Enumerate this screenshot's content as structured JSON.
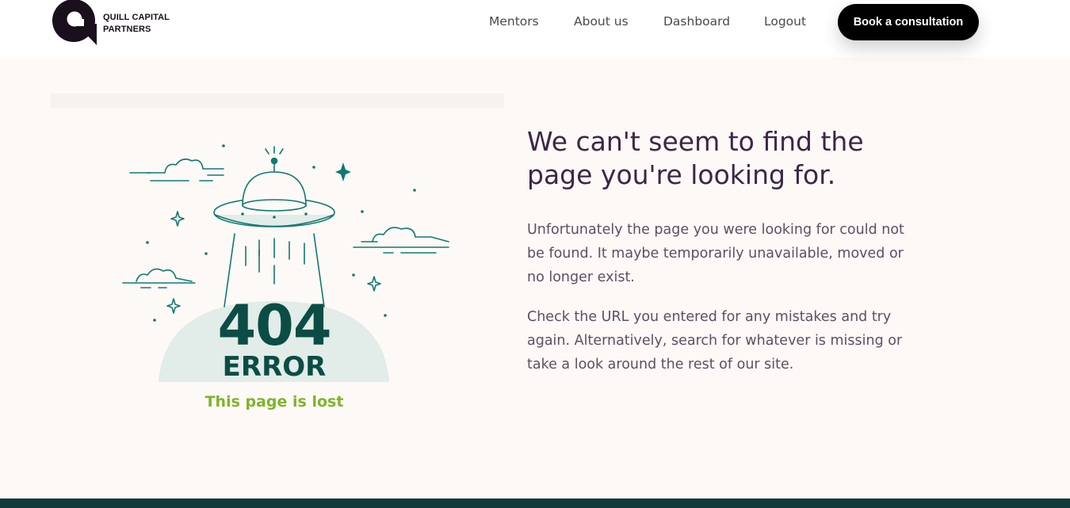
{
  "header": {
    "brand": {
      "line1": "QUILL CAPITAL",
      "line2": "PARTNERS"
    },
    "nav": [
      {
        "label": "Mentors"
      },
      {
        "label": "About us"
      },
      {
        "label": "Dashboard"
      },
      {
        "label": "Logout"
      }
    ],
    "cta_label": "Book a consultation"
  },
  "error": {
    "code": "404",
    "word": "ERROR",
    "tagline": "This page is lost"
  },
  "main": {
    "heading": "We can't seem to find the page you're looking for.",
    "paragraphs": [
      "Unfortunately the page you were looking for could not be found. It maybe temporarily unavailable, moved or no longer exist.",
      "Check the URL you entered for any mistakes and try again. Alternatively, search for whatever is missing or take a look around the rest of our site."
    ]
  },
  "colors": {
    "page_bg": "#fdf9f6",
    "brand_dark": "#1a0f1c",
    "heading": "#3f2548",
    "body_text": "#5e4f63",
    "teal": "#0f7a70",
    "error_text": "#0b4d45",
    "lost_green": "#7db52a",
    "footer": "#0f3b3b"
  },
  "icons": {
    "logo": "quill-q-logo-icon",
    "ufo": "ufo-icon"
  }
}
